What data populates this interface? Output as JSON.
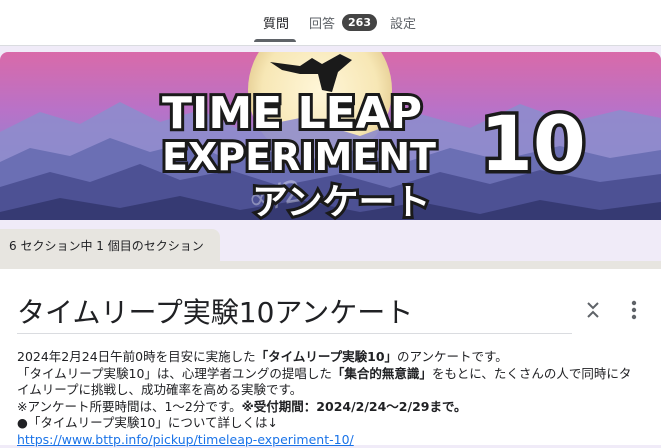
{
  "tabs": {
    "questions": "質問",
    "responses": "回答",
    "responses_count": "263",
    "settings": "設定"
  },
  "banner": {
    "line1": "TIME LEAP",
    "line2": "EXPERIMENT",
    "number": "10",
    "subtitle": "アンケート"
  },
  "section_label": "6 セクション中 1 個目のセクション",
  "form": {
    "title": "タイムリープ実験10アンケート",
    "desc": {
      "l1_pre": "2024年2月24日午前0時を目安に実施した",
      "l1_bold": "「タイムリープ実験10」",
      "l1_post": "のアンケートです。",
      "l2_pre": "「タイムリープ実験10」は、心理学者ユングの提唱した",
      "l2_bold": "「集合的無意識」",
      "l2_post": "をもとに、たくさんの人で同時にタ",
      "l3": "イムリープに挑戦し、成功確率を高める実験です。",
      "l4_pre": "※アンケート所要時間は、1〜2分です。",
      "l4_bold": "※受付期間：2024/2/24〜2/29まで。",
      "l5": "●「タイムリープ実験10」について詳しくは↓",
      "link": "https://www.bttp.info/pickup/timeleap-experiment-10/"
    }
  },
  "colors": {
    "page_bg": "#f0ebf8",
    "link": "#1a73e8",
    "badge_bg": "#444444"
  },
  "icons": [
    "collapse-icon",
    "more-vert-icon"
  ]
}
